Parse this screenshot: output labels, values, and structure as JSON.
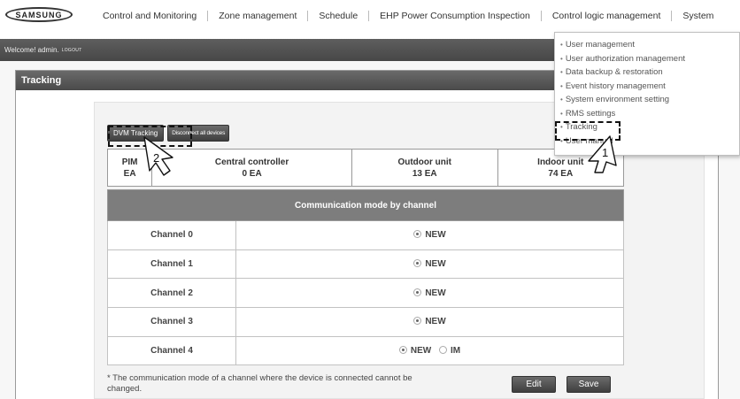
{
  "brand": "SAMSUNG",
  "nav": [
    "Control and Monitoring",
    "Zone management",
    "Schedule",
    "EHP Power Consumption Inspection",
    "Control logic management",
    "System"
  ],
  "welcome": {
    "text": "Welcome! admin.",
    "logout": "LOGOUT"
  },
  "panel_title": "Tracking",
  "buttons": {
    "dvm_tracking": "DVM Tracking",
    "disconnect": "Disconnect all devices",
    "edit": "Edit",
    "save": "Save"
  },
  "summary": [
    {
      "label": "PIM",
      "value": "EA"
    },
    {
      "label": "Central controller",
      "value": "0 EA"
    },
    {
      "label": "Outdoor unit",
      "value": "13 EA"
    },
    {
      "label": "Indoor unit",
      "value": "74 EA"
    }
  ],
  "comm_header": "Communication mode by channel",
  "channels": [
    {
      "name": "Channel 0",
      "options": [
        "NEW"
      ]
    },
    {
      "name": "Channel 1",
      "options": [
        "NEW"
      ]
    },
    {
      "name": "Channel 2",
      "options": [
        "NEW"
      ]
    },
    {
      "name": "Channel 3",
      "options": [
        "NEW"
      ]
    },
    {
      "name": "Channel 4",
      "options": [
        "NEW",
        "IM"
      ]
    }
  ],
  "note": "* The communication mode of a channel where the device is connected cannot be changed.",
  "menu": [
    "User management",
    "User authorization management",
    "Data backup & restoration",
    "Event history management",
    "System environment setting",
    "RMS settings",
    "Tracking",
    "User manual"
  ],
  "callouts": {
    "step1": "1",
    "step2": "2"
  }
}
